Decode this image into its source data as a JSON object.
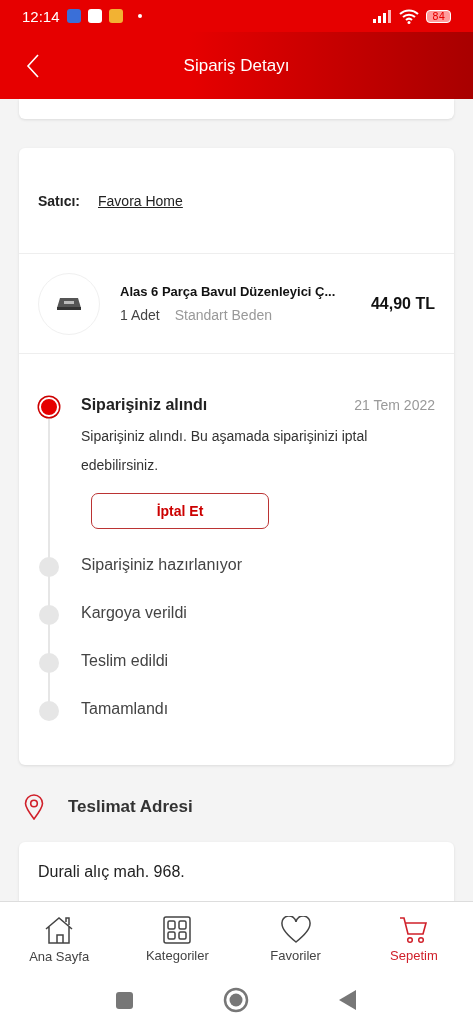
{
  "status_bar": {
    "time": "12:14",
    "battery": "84"
  },
  "header": {
    "title": "Sipariş Detayı"
  },
  "seller": {
    "label": "Satıcı:",
    "name": "Favora Home"
  },
  "product": {
    "name": "Alas 6 Parça Bavul Düzenleyici Ç...",
    "quantity": "1 Adet",
    "size": "Standart Beden",
    "price": "44,90 TL"
  },
  "steps": [
    {
      "title": "Siparişiniz alındı",
      "active": true,
      "date": "21 Tem 2022",
      "description": "Siparişiniz alındı. Bu aşamada siparişinizi iptal edebilirsiniz.",
      "button": "İptal Et"
    },
    {
      "title": "Siparişiniz hazırlanıyor",
      "active": false
    },
    {
      "title": "Kargoya verildi",
      "active": false
    },
    {
      "title": "Teslim edildi",
      "active": false
    },
    {
      "title": "Tamamlandı",
      "active": false
    }
  ],
  "address": {
    "heading": "Teslimat Adresi",
    "line": "Durali alıç mah. 968."
  },
  "bottom_nav": [
    {
      "label": "Ana Sayfa",
      "kind": "home",
      "selected": false
    },
    {
      "label": "Kategoriler",
      "kind": "grid",
      "selected": false
    },
    {
      "label": "Favoriler",
      "kind": "heart",
      "selected": false
    },
    {
      "label": "Sepetim",
      "kind": "cart",
      "selected": true
    }
  ]
}
